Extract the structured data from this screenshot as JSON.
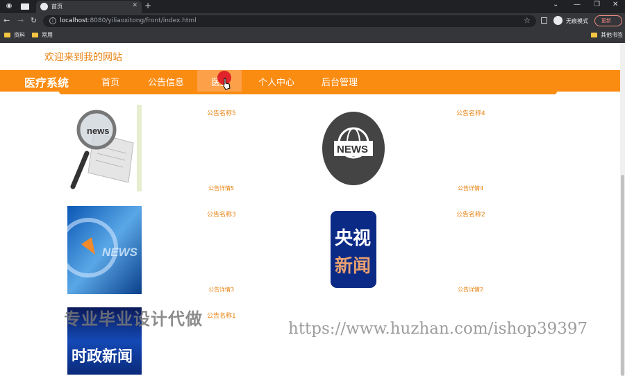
{
  "browser": {
    "tab_title": "首页",
    "url_host": "localhost",
    "url_path": ":8080/yiliaoxitong/front/index.html",
    "incognito_label": "无痕模式",
    "update_label": "更新",
    "bookmarks": [
      "资料",
      "常用"
    ],
    "other_bookmarks": "其他书签"
  },
  "site": {
    "welcome": "欢迎来到我的网站",
    "brand": "医疗系统",
    "nav": [
      "首页",
      "公告信息",
      "医生",
      "个人中心",
      "后台管理"
    ],
    "active_nav": 2
  },
  "news": [
    {
      "title": "公告名称5",
      "detail": "公告详情5",
      "image": "magnifier-news-icon"
    },
    {
      "title": "公告名称4",
      "detail": "公告详情4",
      "image": "globe-news-icon"
    },
    {
      "title": "公告名称3",
      "detail": "公告详情3",
      "image": "blue-news-banner"
    },
    {
      "title": "公告名称2",
      "detail": "公告详情2",
      "image": "cctv-news-logo"
    },
    {
      "title": "公告名称1",
      "detail": "",
      "image": "current-affairs-news"
    }
  ],
  "image_text": {
    "news": "news",
    "news_caps": "NEWS",
    "cctv_top": "央视",
    "cctv_bottom": "新闻",
    "politics": "时政新闻"
  },
  "watermark": {
    "left": "专业毕业设计代做",
    "right": "https://www.huzhan.com/ishop39397"
  },
  "colors": {
    "accent": "#fb8c12",
    "text_accent": "#e8800f"
  }
}
